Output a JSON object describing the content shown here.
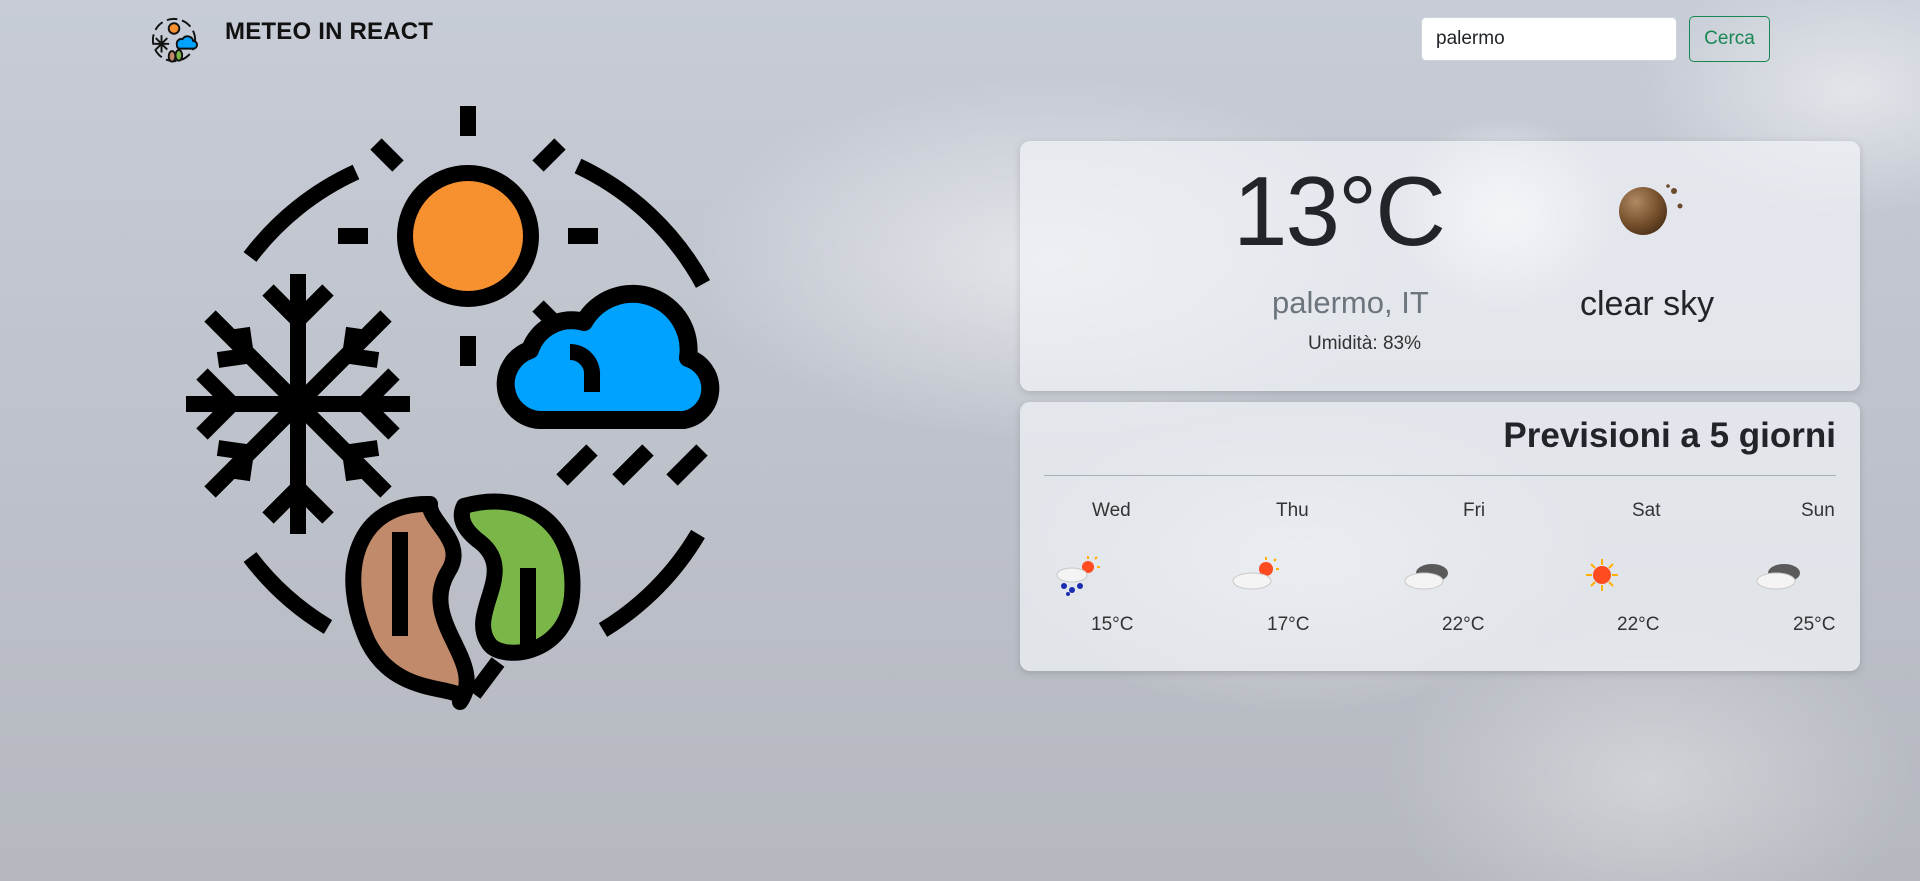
{
  "navbar": {
    "brand": "METEO IN REACT",
    "logo_icon": "seasons-logo-icon"
  },
  "search": {
    "value": "palermo",
    "button_label": "Cerca"
  },
  "hero": {
    "icon": "four-seasons-illustration-icon"
  },
  "current": {
    "temperature": "13°C",
    "location": "palermo, IT",
    "humidity": "Umidità: 83%",
    "condition": "clear sky",
    "condition_icon": "clear-sky-night-icon"
  },
  "forecast": {
    "title": "Previsioni a 5 giorni",
    "days": [
      {
        "day": "Wed",
        "temp": "15°C",
        "icon": "rain-sun-icon"
      },
      {
        "day": "Thu",
        "temp": "17°C",
        "icon": "few-clouds-sun-icon"
      },
      {
        "day": "Fri",
        "temp": "22°C",
        "icon": "broken-clouds-icon"
      },
      {
        "day": "Sat",
        "temp": "22°C",
        "icon": "sun-icon"
      },
      {
        "day": "Sun",
        "temp": "25°C",
        "icon": "broken-clouds-icon"
      }
    ]
  },
  "colors": {
    "accent": "#198754",
    "sun": "#f7902f",
    "cloud": "#00a2ff",
    "leaf_green": "#7ab648",
    "leaf_brown": "#c18a6a"
  }
}
